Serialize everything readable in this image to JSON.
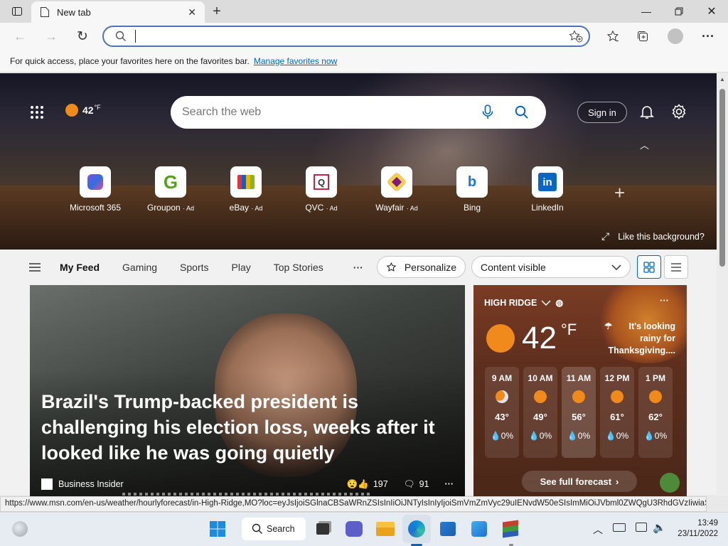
{
  "tab": {
    "title": "New tab"
  },
  "address": {
    "placeholder": ""
  },
  "favorites_bar": {
    "message": "For quick access, place your favorites here on the favorites bar.",
    "link": "Manage favorites now"
  },
  "ntp": {
    "temperature": "42",
    "temp_unit": "°F",
    "search_placeholder": "Search the web",
    "sign_in": "Sign in",
    "quick_links": [
      {
        "label": "Microsoft 365",
        "ad": ""
      },
      {
        "label": "Groupon",
        "ad": "· Ad"
      },
      {
        "label": "eBay",
        "ad": "· Ad"
      },
      {
        "label": "QVC",
        "ad": "· Ad"
      },
      {
        "label": "Wayfair",
        "ad": "· Ad"
      },
      {
        "label": "Bing",
        "ad": ""
      },
      {
        "label": "LinkedIn",
        "ad": ""
      }
    ],
    "like_background": "Like this background?"
  },
  "feed_nav": {
    "items": [
      "My Feed",
      "Gaming",
      "Sports",
      "Play",
      "Top Stories"
    ],
    "more": "···",
    "personalize": "Personalize",
    "content_visible": "Content visible"
  },
  "article": {
    "headline": "Brazil's Trump-backed president is challenging his election loss, weeks after it looked like he was going quietly",
    "source": "Business Insider",
    "reactions": "197",
    "comments": "91"
  },
  "weather": {
    "location": "HIGH RIDGE",
    "temp": "42",
    "unit": "°F",
    "alert": "It's looking rainy for Thanksgiving....",
    "hours": [
      {
        "time": "9 AM",
        "temp": "43°",
        "precip": "0%",
        "icon": "partly-cloudy-icon"
      },
      {
        "time": "10 AM",
        "temp": "49°",
        "precip": "0%",
        "icon": "sun-icon"
      },
      {
        "time": "11 AM",
        "temp": "56°",
        "precip": "0%",
        "icon": "sun-icon"
      },
      {
        "time": "12 PM",
        "temp": "61°",
        "precip": "0%",
        "icon": "sun-icon"
      },
      {
        "time": "1 PM",
        "temp": "62°",
        "precip": "0%",
        "icon": "sun-icon"
      }
    ],
    "forecast_button": "See full forecast"
  },
  "status_url": "https://www.msn.com/en-us/weather/hourlyforecast/in-High-Ridge,MO?loc=eyJsIjoiSGlnaCBSaWRnZSIsInIiOiJNTyIsInIyIjoiSmVmZmVyc29uIENvdW50eSIsImMiOiJVbml0ZWQgU3RhdGVzIiwiaSI6IlVTIiwiZyI6ImVuLXVzIiwieCI6Ii05MC41MzIzIiwieSI6IjM4LjQ1ODQifQ%3D%3D",
  "taskbar": {
    "search": "Search",
    "time": "13:49",
    "date": "23/11/2022"
  },
  "colors": {
    "accent": "#0067c0",
    "weather_sun": "#f08a1a"
  }
}
